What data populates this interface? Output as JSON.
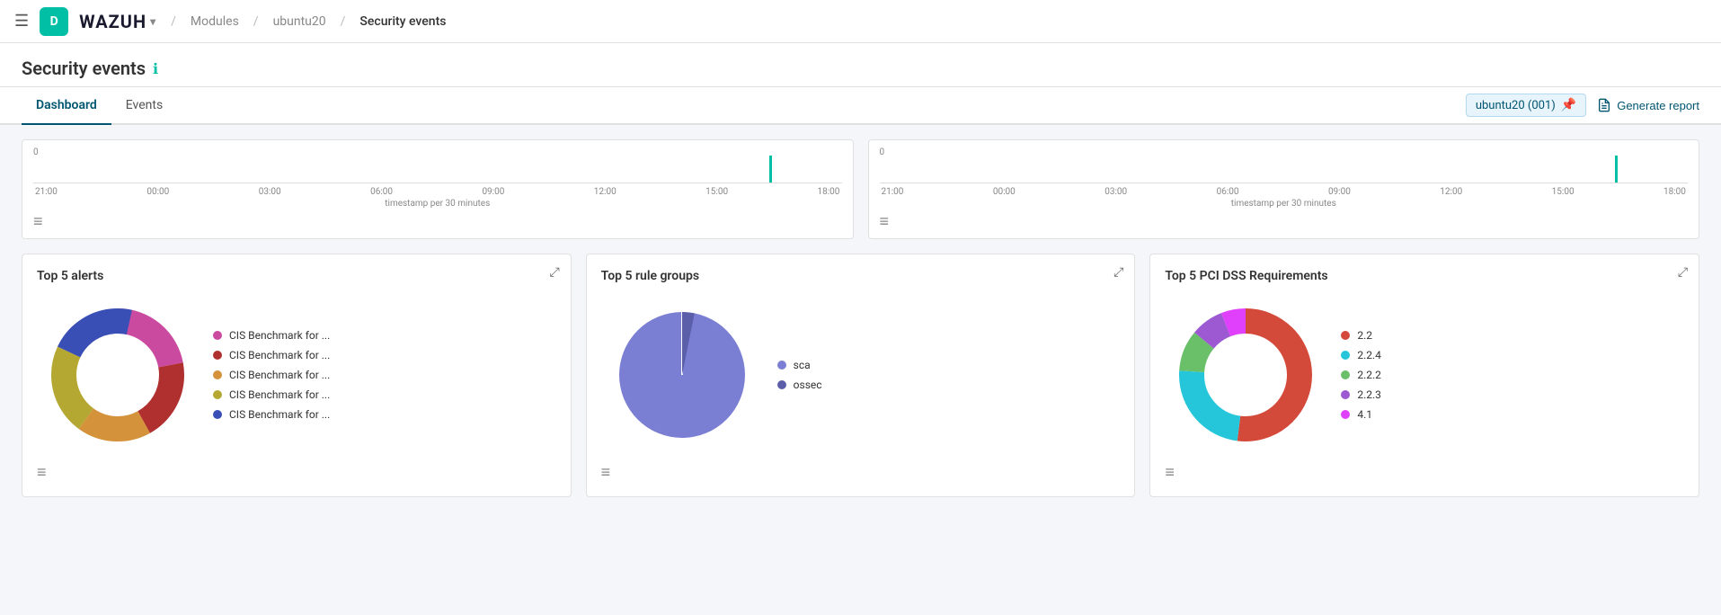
{
  "topnav": {
    "hamburger": "☰",
    "avatar_letter": "D",
    "brand": "WAZUH",
    "modules": "Modules",
    "agent": "ubuntu20",
    "current_page": "Security events"
  },
  "page": {
    "title": "Security events",
    "info_icon": "ℹ"
  },
  "tabs": [
    {
      "label": "Dashboard",
      "active": true
    },
    {
      "label": "Events",
      "active": false
    }
  ],
  "actions": {
    "agent_badge": "ubuntu20 (001)",
    "generate_report": "Generate report"
  },
  "timeline1": {
    "zero": "0",
    "labels": [
      "21:00",
      "00:00",
      "03:00",
      "06:00",
      "09:00",
      "12:00",
      "15:00",
      "18:00"
    ],
    "footer": "timestamp per 30 minutes",
    "bar_position_pct": 92
  },
  "timeline2": {
    "zero": "0",
    "labels": [
      "21:00",
      "00:00",
      "03:00",
      "06:00",
      "09:00",
      "12:00",
      "15:00",
      "18:00"
    ],
    "footer": "timestamp per 30 minutes",
    "bar_position_pct": 92
  },
  "chart1": {
    "title": "Top 5 alerts",
    "legend": [
      {
        "label": "CIS Benchmark for ...",
        "color": "#c94a9f"
      },
      {
        "label": "CIS Benchmark for ...",
        "color": "#b03030"
      },
      {
        "label": "CIS Benchmark for ...",
        "color": "#d4923a"
      },
      {
        "label": "CIS Benchmark for ...",
        "color": "#b5a832"
      },
      {
        "label": "CIS Benchmark for ...",
        "color": "#3a4fb5"
      }
    ],
    "segments": [
      {
        "color": "#c94a9f",
        "pct": 22
      },
      {
        "color": "#b03030",
        "pct": 20
      },
      {
        "color": "#d4923a",
        "pct": 18
      },
      {
        "color": "#b5a832",
        "pct": 22
      },
      {
        "color": "#3a4fb5",
        "pct": 18
      }
    ]
  },
  "chart2": {
    "title": "Top 5 rule groups",
    "legend": [
      {
        "label": "sca",
        "color": "#7b7fd4"
      },
      {
        "label": "ossec",
        "color": "#5b5faa"
      }
    ],
    "segments": [
      {
        "color": "#7b7fd4",
        "pct": 96
      },
      {
        "color": "#5b5faa",
        "pct": 4
      }
    ]
  },
  "chart3": {
    "title": "Top 5 PCI DSS Requirements",
    "legend": [
      {
        "label": "2.2",
        "color": "#d44a3a"
      },
      {
        "label": "2.2.4",
        "color": "#26c6da"
      },
      {
        "label": "2.2.2",
        "color": "#6abf69"
      },
      {
        "label": "2.2.3",
        "color": "#9c59d1"
      },
      {
        "label": "4.1",
        "color": "#e040fb"
      }
    ],
    "segments": [
      {
        "color": "#d44a3a",
        "pct": 52
      },
      {
        "color": "#26c6da",
        "pct": 24
      },
      {
        "color": "#6abf69",
        "pct": 10
      },
      {
        "color": "#9c59d1",
        "pct": 8
      },
      {
        "color": "#e040fb",
        "pct": 6
      }
    ]
  }
}
